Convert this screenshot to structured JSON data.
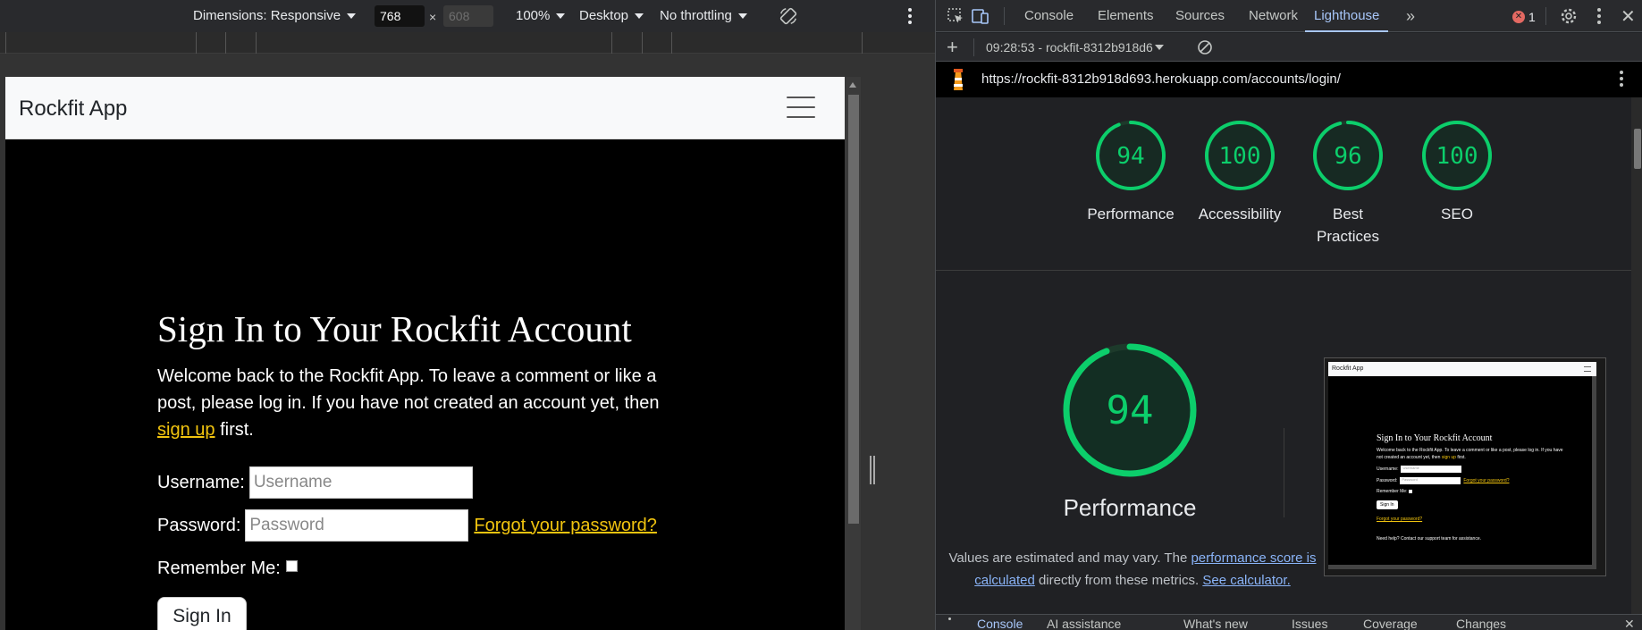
{
  "device_toolbar": {
    "dimensions_label": "Dimensions: Responsive",
    "width": "768",
    "height": "608",
    "times": "×",
    "zoom": "100%",
    "device_type": "Desktop",
    "throttling": "No throttling"
  },
  "site": {
    "brand": "Rockfit App",
    "heading": "Sign In to Your Rockfit Account",
    "intro_before": "Welcome back to the Rockfit App. To leave a comment or like a post, please log in. If you have not created an account yet, then ",
    "signup_link": "sign up",
    "intro_after": "first.",
    "username_label": "Username:",
    "username_placeholder": "Username",
    "password_label": "Password:",
    "password_placeholder": "Password",
    "forgot_link": "Forgot your password?",
    "remember_label": "Remember Me:",
    "signin_button": "Sign In"
  },
  "devtools": {
    "tabs": [
      "Console",
      "Elements",
      "Sources",
      "Network",
      "Lighthouse"
    ],
    "active_tab": "Lighthouse",
    "more_tabs": "»",
    "error_count": "1",
    "report_label": "09:28:53 - rockfit-8312b918d6",
    "url": "https://rockfit-8312b918d693.herokuapp.com/accounts/login/"
  },
  "lighthouse": {
    "scores": [
      {
        "label": "Performance",
        "score": 94
      },
      {
        "label": "Accessibility",
        "score": 100
      },
      {
        "label": "Best Practices",
        "score": 96
      },
      {
        "label": "SEO",
        "score": 100
      }
    ],
    "big_score": 94,
    "big_title": "Performance",
    "note_before": "Values are estimated and may vary. The ",
    "note_link1": "performance score is calculated",
    "note_middle": " directly from these metrics. ",
    "note_link2": "See calculator.",
    "pass_color": "#0cce6b"
  },
  "thumbnail": {
    "brand": "Rockfit App",
    "heading": "Sign In to Your Rockfit Account",
    "text1": "Welcome back to the Rockfit App. To leave a comment or like a post, please log in. If you have not created an account yet, then",
    "link": "sign up",
    "first": "first.",
    "username": "Username:",
    "username_ph": "Username",
    "password": "Password:",
    "password_ph": "Password",
    "forgot": "Forgot your password?",
    "remember": "Remember Me:",
    "signin": "Sign In",
    "forgot2": "Forgot your password?",
    "help": "Need help? Contact our support team for assistance."
  },
  "drawer": {
    "tabs": [
      "Console",
      "AI assistance",
      "What's new",
      "Issues",
      "Coverage",
      "Changes"
    ]
  }
}
